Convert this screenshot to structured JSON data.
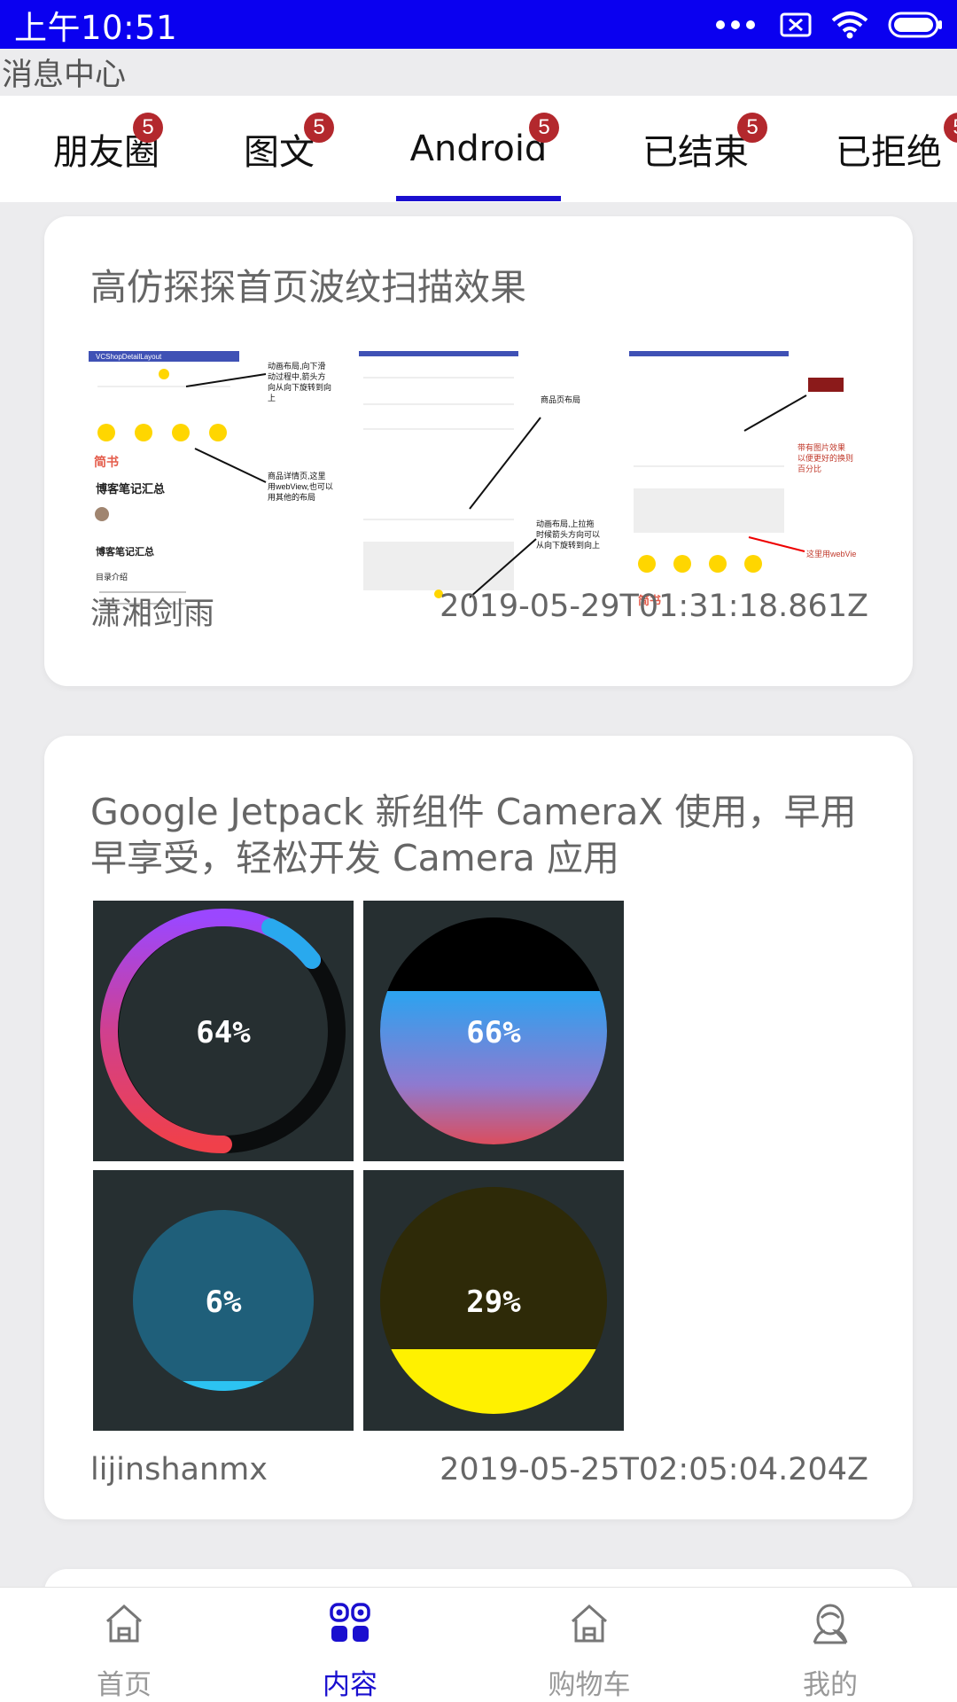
{
  "status_bar": {
    "time": "上午10:51"
  },
  "header": {
    "title": "消息中心"
  },
  "tabs": [
    {
      "label": "朋友圈",
      "badge": "5"
    },
    {
      "label": "图文",
      "badge": "5"
    },
    {
      "label": "Android",
      "badge": "5",
      "active": true
    },
    {
      "label": "已结束",
      "badge": "5"
    },
    {
      "label": "已拒绝",
      "badge": "5"
    }
  ],
  "articles": [
    {
      "title": "高仿探探首页波纹扫描效果",
      "author": "潇湘剑雨",
      "date": "2019-05-29T01:31:18.861Z",
      "screenshot_text": {
        "layout_title": "VCShopDetailLayout",
        "a1": "动画布局,向下滑",
        "a2": "动过程中,箭头方",
        "a3": "向从向下旋转到向",
        "a4": "上",
        "brand": "简书",
        "blog1": "博客笔记汇总",
        "blog2": "博客笔记汇总",
        "toc": "目录介绍",
        "b1": "商品详情页,这里",
        "b2": "用webView,也可以",
        "b3": "用其他的布局",
        "c1": "商品页布局",
        "d1": "动画布局,上拉拖",
        "d2": "时候箭头方向可以",
        "d3": "从向下旋转到向上",
        "e1": "带有图片效果",
        "e2": "以便更好的换则",
        "e3": "百分比",
        "f1": "这里用webVie"
      },
      "percents": []
    },
    {
      "title": "Google Jetpack 新组件 CameraX 使用，早用早享受，轻松开发 Camera 应用",
      "author": "lijinshanmx",
      "date": "2019-05-25T02:05:04.204Z",
      "percents": [
        "64%",
        "66%",
        "6%",
        "29%"
      ]
    }
  ],
  "bottom_nav": [
    {
      "label": "首页",
      "icon": "home-icon"
    },
    {
      "label": "内容",
      "icon": "content-grid-icon",
      "active": true
    },
    {
      "label": "购物车",
      "icon": "shop-icon"
    },
    {
      "label": "我的",
      "icon": "profile-icon"
    }
  ],
  "colors": {
    "status_bar": "#0a00f0",
    "accent": "#1a0fcf",
    "badge": "#b3282d"
  }
}
